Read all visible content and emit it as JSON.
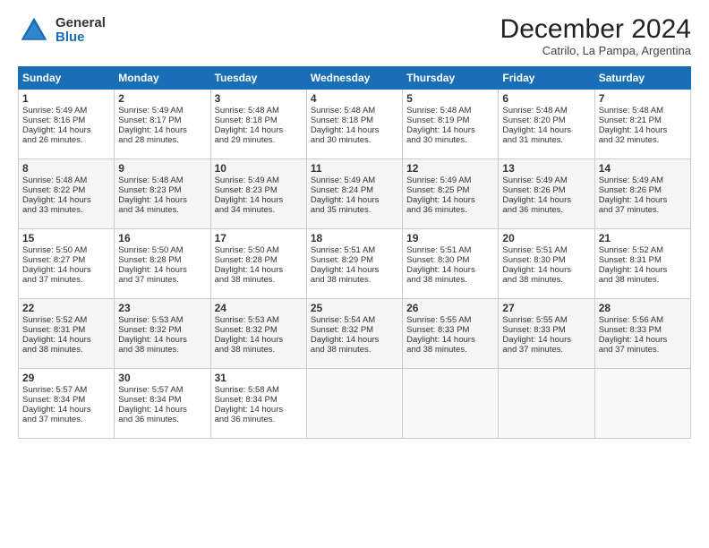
{
  "logo": {
    "general": "General",
    "blue": "Blue"
  },
  "header": {
    "month": "December 2024",
    "location": "Catrilo, La Pampa, Argentina"
  },
  "weekdays": [
    "Sunday",
    "Monday",
    "Tuesday",
    "Wednesday",
    "Thursday",
    "Friday",
    "Saturday"
  ],
  "weeks": [
    [
      {
        "day": "1",
        "sunrise": "5:49 AM",
        "sunset": "8:16 PM",
        "daylight": "14 hours and 26 minutes."
      },
      {
        "day": "2",
        "sunrise": "5:49 AM",
        "sunset": "8:17 PM",
        "daylight": "14 hours and 28 minutes."
      },
      {
        "day": "3",
        "sunrise": "5:48 AM",
        "sunset": "8:18 PM",
        "daylight": "14 hours and 29 minutes."
      },
      {
        "day": "4",
        "sunrise": "5:48 AM",
        "sunset": "8:18 PM",
        "daylight": "14 hours and 30 minutes."
      },
      {
        "day": "5",
        "sunrise": "5:48 AM",
        "sunset": "8:19 PM",
        "daylight": "14 hours and 30 minutes."
      },
      {
        "day": "6",
        "sunrise": "5:48 AM",
        "sunset": "8:20 PM",
        "daylight": "14 hours and 31 minutes."
      },
      {
        "day": "7",
        "sunrise": "5:48 AM",
        "sunset": "8:21 PM",
        "daylight": "14 hours and 32 minutes."
      }
    ],
    [
      {
        "day": "8",
        "sunrise": "5:48 AM",
        "sunset": "8:22 PM",
        "daylight": "14 hours and 33 minutes."
      },
      {
        "day": "9",
        "sunrise": "5:48 AM",
        "sunset": "8:23 PM",
        "daylight": "14 hours and 34 minutes."
      },
      {
        "day": "10",
        "sunrise": "5:49 AM",
        "sunset": "8:23 PM",
        "daylight": "14 hours and 34 minutes."
      },
      {
        "day": "11",
        "sunrise": "5:49 AM",
        "sunset": "8:24 PM",
        "daylight": "14 hours and 35 minutes."
      },
      {
        "day": "12",
        "sunrise": "5:49 AM",
        "sunset": "8:25 PM",
        "daylight": "14 hours and 36 minutes."
      },
      {
        "day": "13",
        "sunrise": "5:49 AM",
        "sunset": "8:26 PM",
        "daylight": "14 hours and 36 minutes."
      },
      {
        "day": "14",
        "sunrise": "5:49 AM",
        "sunset": "8:26 PM",
        "daylight": "14 hours and 37 minutes."
      }
    ],
    [
      {
        "day": "15",
        "sunrise": "5:50 AM",
        "sunset": "8:27 PM",
        "daylight": "14 hours and 37 minutes."
      },
      {
        "day": "16",
        "sunrise": "5:50 AM",
        "sunset": "8:28 PM",
        "daylight": "14 hours and 37 minutes."
      },
      {
        "day": "17",
        "sunrise": "5:50 AM",
        "sunset": "8:28 PM",
        "daylight": "14 hours and 38 minutes."
      },
      {
        "day": "18",
        "sunrise": "5:51 AM",
        "sunset": "8:29 PM",
        "daylight": "14 hours and 38 minutes."
      },
      {
        "day": "19",
        "sunrise": "5:51 AM",
        "sunset": "8:30 PM",
        "daylight": "14 hours and 38 minutes."
      },
      {
        "day": "20",
        "sunrise": "5:51 AM",
        "sunset": "8:30 PM",
        "daylight": "14 hours and 38 minutes."
      },
      {
        "day": "21",
        "sunrise": "5:52 AM",
        "sunset": "8:31 PM",
        "daylight": "14 hours and 38 minutes."
      }
    ],
    [
      {
        "day": "22",
        "sunrise": "5:52 AM",
        "sunset": "8:31 PM",
        "daylight": "14 hours and 38 minutes."
      },
      {
        "day": "23",
        "sunrise": "5:53 AM",
        "sunset": "8:32 PM",
        "daylight": "14 hours and 38 minutes."
      },
      {
        "day": "24",
        "sunrise": "5:53 AM",
        "sunset": "8:32 PM",
        "daylight": "14 hours and 38 minutes."
      },
      {
        "day": "25",
        "sunrise": "5:54 AM",
        "sunset": "8:32 PM",
        "daylight": "14 hours and 38 minutes."
      },
      {
        "day": "26",
        "sunrise": "5:55 AM",
        "sunset": "8:33 PM",
        "daylight": "14 hours and 38 minutes."
      },
      {
        "day": "27",
        "sunrise": "5:55 AM",
        "sunset": "8:33 PM",
        "daylight": "14 hours and 37 minutes."
      },
      {
        "day": "28",
        "sunrise": "5:56 AM",
        "sunset": "8:33 PM",
        "daylight": "14 hours and 37 minutes."
      }
    ],
    [
      {
        "day": "29",
        "sunrise": "5:57 AM",
        "sunset": "8:34 PM",
        "daylight": "14 hours and 37 minutes."
      },
      {
        "day": "30",
        "sunrise": "5:57 AM",
        "sunset": "8:34 PM",
        "daylight": "14 hours and 36 minutes."
      },
      {
        "day": "31",
        "sunrise": "5:58 AM",
        "sunset": "8:34 PM",
        "daylight": "14 hours and 36 minutes."
      },
      null,
      null,
      null,
      null
    ]
  ]
}
